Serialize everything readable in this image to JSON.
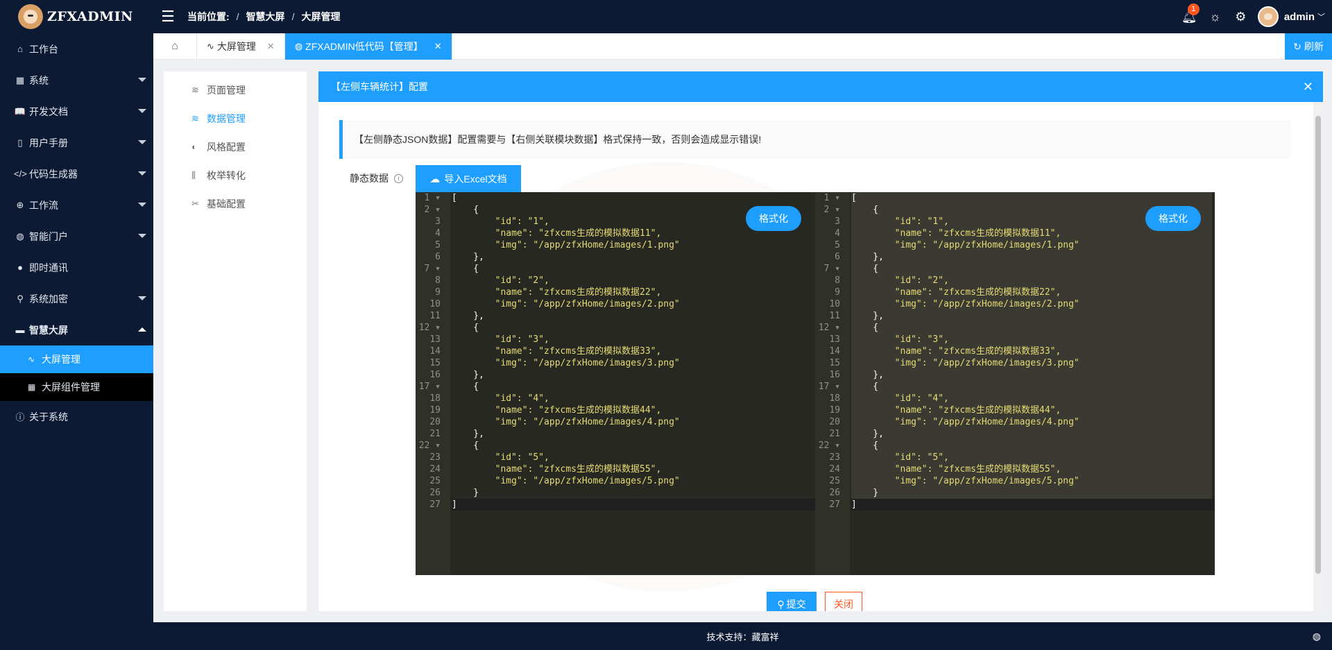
{
  "app": {
    "name": "ZFXADMIN"
  },
  "breadcrumb": {
    "label": "当前位置:",
    "items": [
      "智慧大屏",
      "大屏管理"
    ]
  },
  "topbar": {
    "notification_count": "1",
    "username": "admin"
  },
  "sidebar": {
    "items": [
      {
        "label": "工作台",
        "icon": "home-icon",
        "glyph": "⌂"
      },
      {
        "label": "系统",
        "icon": "apps-icon",
        "glyph": "▦",
        "arrow": true
      },
      {
        "label": "开发文档",
        "icon": "book-icon",
        "glyph": "📖",
        "arrow": true
      },
      {
        "label": "用户手册",
        "icon": "manual-icon",
        "glyph": "▯",
        "arrow": true
      },
      {
        "label": "代码生成器",
        "icon": "code-icon",
        "glyph": "</>",
        "arrow": true
      },
      {
        "label": "工作流",
        "icon": "flow-icon",
        "glyph": "⊕",
        "arrow": true
      },
      {
        "label": "智能门户",
        "icon": "globe-icon",
        "glyph": "◍",
        "arrow": true
      },
      {
        "label": "即时通讯",
        "icon": "chat-icon",
        "glyph": "●"
      },
      {
        "label": "系统加密",
        "icon": "key-icon",
        "glyph": "⚲",
        "arrow": true
      },
      {
        "label": "智慧大屏",
        "icon": "screen-icon",
        "glyph": "▬",
        "open": true
      }
    ],
    "sub_items": [
      {
        "label": "大屏管理",
        "icon": "pulse-icon",
        "glyph": "∿",
        "active": true
      },
      {
        "label": "大屏组件管理",
        "icon": "components-icon",
        "glyph": "▦"
      }
    ],
    "after_items": [
      {
        "label": "关于系统",
        "icon": "info-icon",
        "glyph": "ⓘ"
      }
    ]
  },
  "tabs": {
    "items": [
      {
        "label": "大屏管理",
        "glyph": "∿"
      },
      {
        "label": "ZFXADMIN低代码【管理】",
        "glyph": "◍",
        "active": true
      }
    ],
    "refresh_label": "刷新"
  },
  "left_menu": {
    "items": [
      {
        "label": "页面管理",
        "glyph": "≋"
      },
      {
        "label": "数据管理",
        "glyph": "≋",
        "active": true
      },
      {
        "label": "风格配置",
        "glyph": "◐"
      },
      {
        "label": "枚举转化",
        "glyph": "⫼"
      },
      {
        "label": "基础配置",
        "glyph": "✂"
      }
    ]
  },
  "dialog": {
    "title": "【左侧车辆统计】配置",
    "tip": "【左侧静态JSON数据】配置需要与【右侧关联模块数据】格式保持一致，否则会造成显示错误!",
    "field_label": "静态数据",
    "import_label": "导入Excel文档",
    "format_label": "格式化",
    "submit_label": "提交",
    "close_label": "关闭"
  },
  "editor_left_lines": [
    "[",
    "    {",
    "        \"id\": \"1\",",
    "        \"name\": \"zfxcms生成的模拟数据11\",",
    "        \"img\": \"/app/zfxHome/images/1.png\"",
    "    },",
    "    {",
    "        \"id\": \"2\",",
    "        \"name\": \"zfxcms生成的模拟数据22\",",
    "        \"img\": \"/app/zfxHome/images/2.png\"",
    "    },",
    "    {",
    "        \"id\": \"3\",",
    "        \"name\": \"zfxcms生成的模拟数据33\",",
    "        \"img\": \"/app/zfxHome/images/3.png\"",
    "    },",
    "    {",
    "        \"id\": \"4\",",
    "        \"name\": \"zfxcms生成的模拟数据44\",",
    "        \"img\": \"/app/zfxHome/images/4.png\"",
    "    },",
    "    {",
    "        \"id\": \"5\",",
    "        \"name\": \"zfxcms生成的模拟数据55\",",
    "        \"img\": \"/app/zfxHome/images/5.png\"",
    "    }",
    "]"
  ],
  "fold_lines": [
    1,
    2,
    7,
    12,
    17,
    22
  ],
  "footer": {
    "text": "技术支持：藏富祥"
  },
  "colors": {
    "primary": "#1e9fff",
    "dark": "#0c1a33",
    "danger": "#ff5722",
    "editor_bg": "#272822"
  }
}
